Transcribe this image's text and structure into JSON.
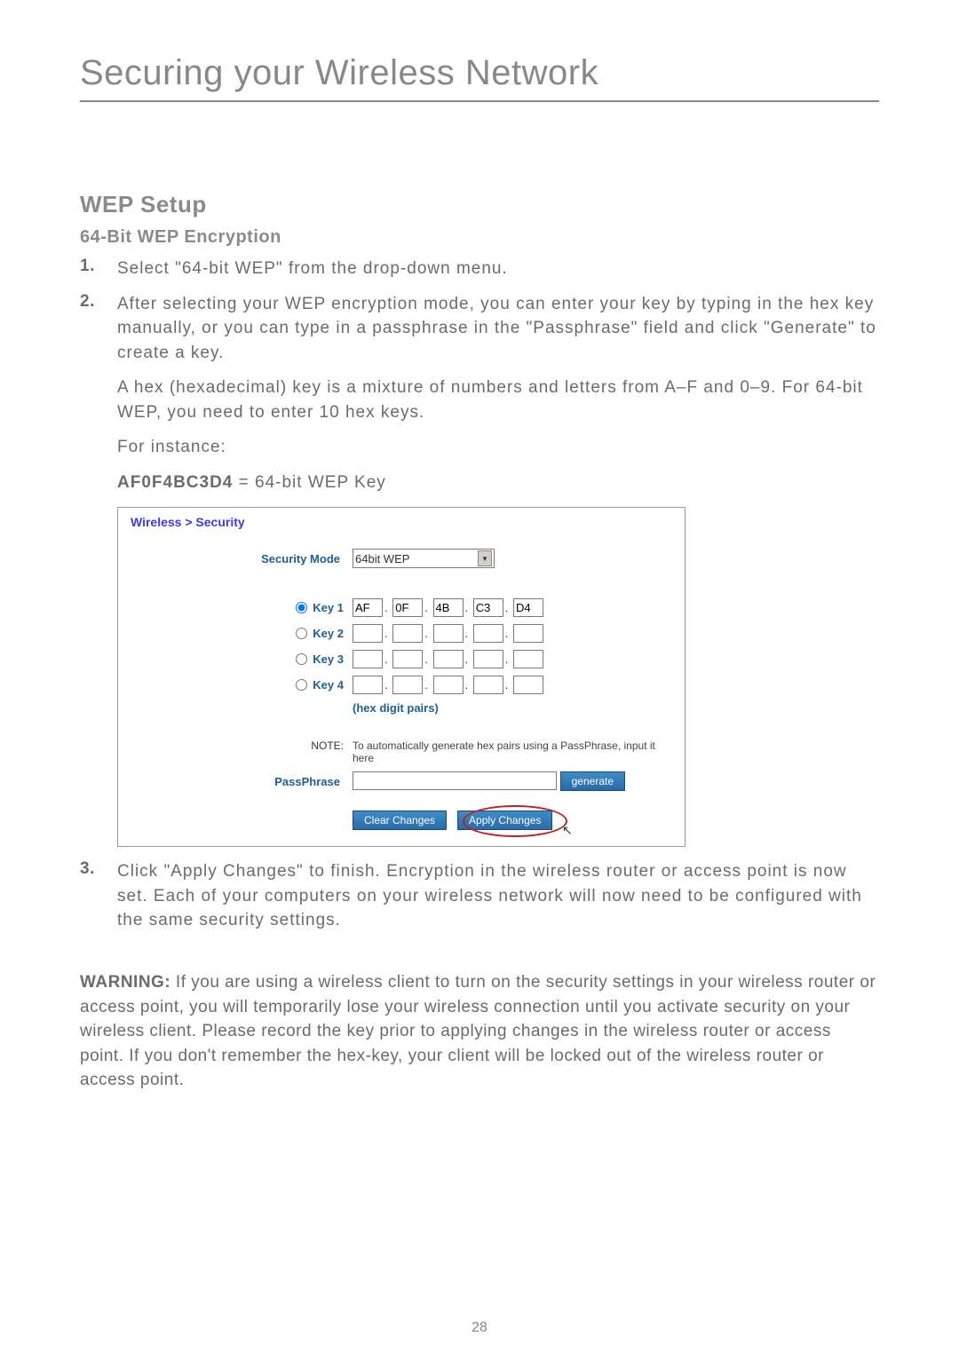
{
  "page": {
    "title": "Securing your Wireless Network",
    "section": "WEP Setup",
    "subsection": "64-Bit WEP Encryption",
    "step1": "Select \"64-bit WEP\" from the drop-down menu.",
    "step2": "After selecting your WEP encryption mode, you can enter your key by typing in the hex key manually, or you can type in a passphrase in the \"Passphrase\" field and click \"Generate\" to create a key.",
    "step2_para2": "A hex (hexadecimal) key is a mixture of numbers and letters from A–F and 0–9. For 64-bit WEP, you need to enter 10 hex keys.",
    "step2_para3": "For instance:",
    "example_key_bold": "AF0F4BC3D4",
    "example_key_rest": " = 64-bit WEP Key",
    "step3": "Click \"Apply Changes\" to finish. Encryption in the wireless router or access point is now set. Each of your computers on your wireless network will now need to be configured with the same security settings.",
    "warning_label": "WARNING:",
    "warning_text": " If you are using a wireless client to turn on the security settings in your wireless router or access point, you will temporarily lose your wireless connection until you activate security on your wireless client. Please record the key prior to applying changes in the wireless router or access point. If you don't remember the hex-key, your client will be locked out of the wireless router or access point.",
    "page_number": "28",
    "num1": "1.",
    "num2": "2.",
    "num3": "3."
  },
  "screenshot": {
    "breadcrumb": "Wireless > Security",
    "security_mode_label": "Security Mode",
    "security_mode_value": "64bit WEP",
    "key_labels": {
      "k1": "Key 1",
      "k2": "Key 2",
      "k3": "Key 3",
      "k4": "Key 4"
    },
    "key1_values": [
      "AF",
      "0F",
      "4B",
      "C3",
      "D4"
    ],
    "empty": "",
    "hex_note": "(hex digit pairs)",
    "note_label": "NOTE:",
    "note_text": "To automatically generate hex pairs using a PassPhrase, input it here",
    "passphrase_label": "PassPhrase",
    "generate_btn": "generate",
    "clear_btn": "Clear Changes",
    "apply_btn": "Apply Changes"
  }
}
